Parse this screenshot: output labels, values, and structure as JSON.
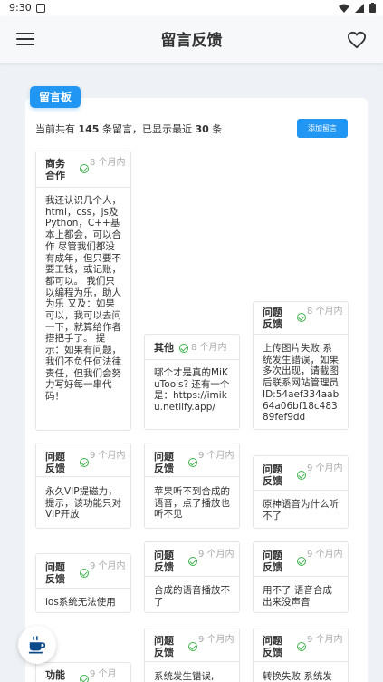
{
  "status": {
    "time": "9:30"
  },
  "appbar": {
    "title": "留言反馈"
  },
  "board_tab": "留言板",
  "summary": {
    "prefix": "当前共有",
    "total": "145",
    "middle": "条留言，已显示最近",
    "shown": "30",
    "suffix": "条"
  },
  "add_button": "添加留言",
  "cards": [
    {
      "category": "商务合作",
      "ago": "8 个月内",
      "body": "我还认识几个人，html，css，js及Python，C++基本上都会，可以合作 尽管我们都没有成年，但只要不要工钱，或记账，都可以。 我们只以编程为乐，助人为乐 又及：如果可以，我可以去问一下，就算给作者搭把手了。 提示：如果有问题，我们不负任何法律责任，但我们会努力写好每一串代码！"
    },
    {
      "category": "其他",
      "ago": "8 个月内",
      "body": "哪个才是真的MiKuTools? 还有一个是：https://imiku.netlify.app/"
    },
    {
      "category": "问题反馈",
      "ago": "8 个月内",
      "body": "上传图片失败 系统发生错误，如果多次出现，请截图后联系网站管理员 ID:54aef334aab64a06bf18c48389fef9dd"
    },
    {
      "category": "问题反馈",
      "ago": "9 个月内",
      "body": "永久VIP提磁力，提示，该功能只对VIP开放"
    },
    {
      "category": "问题反馈",
      "ago": "9 个月内",
      "body": "苹果听不到合成的语音，点了播放也听不见"
    },
    {
      "category": "问题反馈",
      "ago": "9 个月内",
      "body": "原神语音为什么听不了"
    },
    {
      "category": "问题反馈",
      "ago": "9 个月内",
      "body": "ios系统无法使用"
    },
    {
      "category": "问题反馈",
      "ago": "9 个月内",
      "body": "合成的语音播放不了"
    },
    {
      "category": "问题反馈",
      "ago": "9 个月内",
      "body": "用不了 语音合成出来没声音"
    },
    {
      "category": "问题反馈",
      "ago": "9 个月内",
      "body": "系统发生错误,"
    },
    {
      "category": "问题反馈",
      "ago": "9 个月内",
      "body": "转换失败 系统发"
    },
    {
      "category": "功能",
      "ago": "9 个月",
      "body": ""
    }
  ]
}
